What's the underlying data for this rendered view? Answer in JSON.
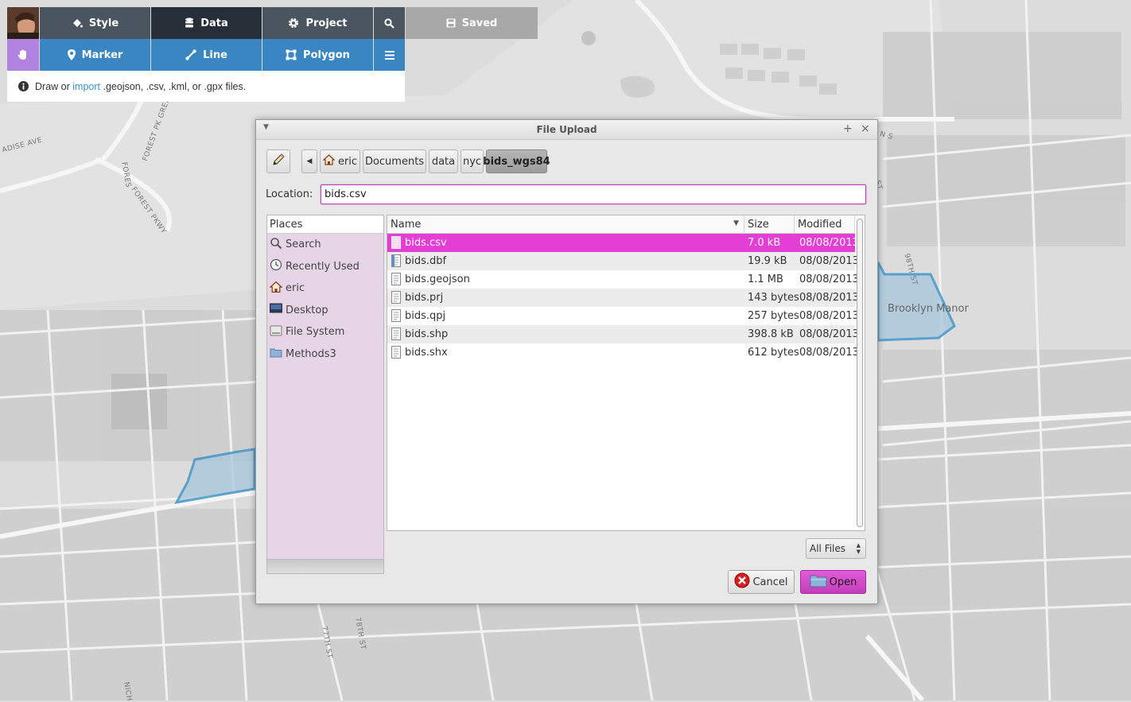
{
  "map": {
    "labels": [
      "ADISE AVE",
      "FOREST PK GREE",
      "FOREST PKWY",
      "FORES",
      "98TH ST",
      "N S",
      "ST",
      "77TH ST",
      "78TH ST",
      "NICH",
      "Brooklyn Manor"
    ]
  },
  "toolbar": {
    "row1": [
      {
        "label": "Style",
        "icon": "paint-bucket-icon"
      },
      {
        "label": "Data",
        "icon": "database-icon"
      },
      {
        "label": "Project",
        "icon": "gear-icon"
      },
      {
        "label": "",
        "icon": "search-icon"
      },
      {
        "label": "Saved",
        "icon": "floppy-disk-icon"
      }
    ],
    "row2": [
      {
        "label": "",
        "icon": "hand-icon"
      },
      {
        "label": "Marker",
        "icon": "map-pin-icon"
      },
      {
        "label": "Line",
        "icon": "line-icon"
      },
      {
        "label": "Polygon",
        "icon": "polygon-icon"
      },
      {
        "label": "",
        "icon": "hamburger-menu-icon"
      }
    ],
    "active_tab": "Data",
    "colors": {
      "dark": "#4a5560",
      "active": "#262f38",
      "accent": "#3a86c2",
      "hand": "#b083e0"
    }
  },
  "info": {
    "prefix": "Draw or",
    "link": "import",
    "suffix": ".geojson, .csv, .kml, or .gpx files."
  },
  "dialog": {
    "title": "File Upload",
    "path": [
      "eric",
      "Documents",
      "data",
      "nyc",
      "bids_wgs84"
    ],
    "location_label": "Location:",
    "location_value": "bids.csv",
    "places_header": "Places",
    "places": [
      {
        "label": "Search",
        "icon": "magnifier-icon"
      },
      {
        "label": "Recently Used",
        "icon": "clock-icon"
      },
      {
        "label": "eric",
        "icon": "home-icon"
      },
      {
        "label": "Desktop",
        "icon": "desktop-icon"
      },
      {
        "label": "File System",
        "icon": "drive-icon"
      },
      {
        "label": "Methods3",
        "icon": "folder-icon"
      }
    ],
    "columns": {
      "name": "Name",
      "size": "Size",
      "modified": "Modified"
    },
    "files": [
      {
        "name": "bids.csv",
        "size": "7.0 kB",
        "modified": "08/08/2013",
        "selected": true
      },
      {
        "name": "bids.dbf",
        "size": "19.9 kB",
        "modified": "08/08/2013"
      },
      {
        "name": "bids.geojson",
        "size": "1.1 MB",
        "modified": "08/08/2013"
      },
      {
        "name": "bids.prj",
        "size": "143 bytes",
        "modified": "08/08/2013"
      },
      {
        "name": "bids.qpj",
        "size": "257 bytes",
        "modified": "08/08/2013"
      },
      {
        "name": "bids.shp",
        "size": "398.8 kB",
        "modified": "08/08/2013"
      },
      {
        "name": "bids.shx",
        "size": "612 bytes",
        "modified": "08/08/2013"
      }
    ],
    "filter": "All Files",
    "cancel_label": "Cancel",
    "open_label": "Open",
    "selection_color": "#e33fd4"
  }
}
